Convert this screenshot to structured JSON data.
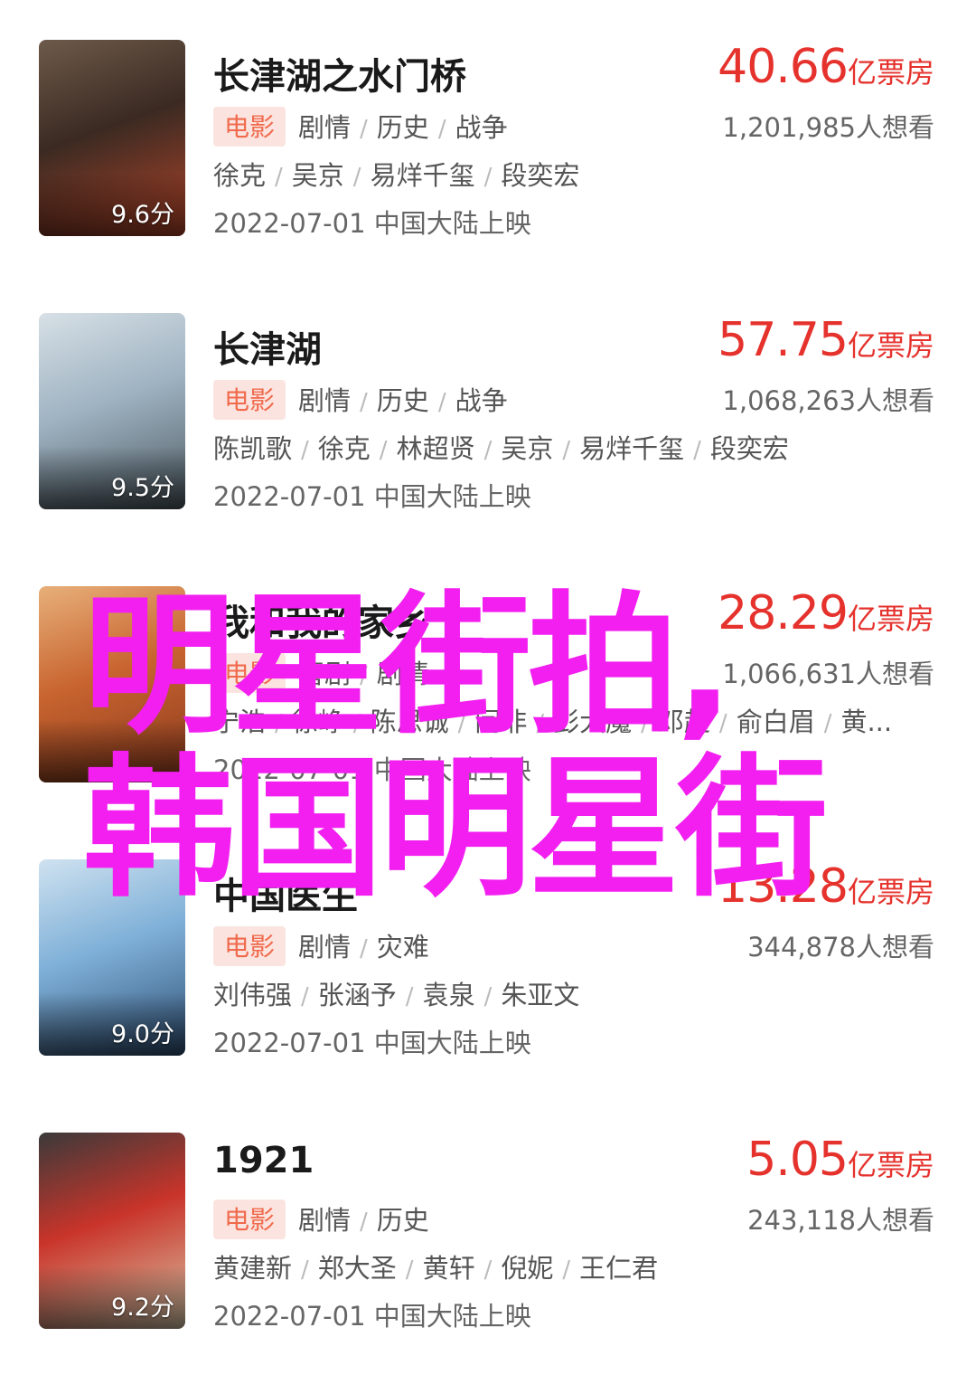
{
  "movies": [
    {
      "title": "长津湖之水门桥",
      "tag": "电影",
      "genres": [
        "剧情",
        "历史",
        "战争"
      ],
      "cast": [
        "徐克",
        "吴京",
        "易烊千玺",
        "段奕宏"
      ],
      "release": "2022-07-01 中国大陆上映",
      "score": "9.6分",
      "box_office": "40.66",
      "box_unit": "亿票房",
      "want": "1,201,985人想看",
      "poster_colors": [
        "#3b2a22",
        "#b4452a",
        "#6d5a4a"
      ]
    },
    {
      "title": "长津湖",
      "tag": "电影",
      "genres": [
        "剧情",
        "历史",
        "战争"
      ],
      "cast": [
        "陈凯歌",
        "徐克",
        "林超贤",
        "吴京",
        "易烊千玺",
        "段奕宏"
      ],
      "release": "2022-07-01 中国大陆上映",
      "score": "9.5分",
      "box_office": "57.75",
      "box_unit": "亿票房",
      "want": "1,068,263人想看",
      "poster_colors": [
        "#9fb3c2",
        "#4d5a62",
        "#d7e0e6"
      ]
    },
    {
      "title": "我和我的家乡",
      "tag": "电影",
      "genres": [
        "喜剧",
        "剧情"
      ],
      "cast": [
        "宁浩",
        "徐峥",
        "陈思诚",
        "闫非",
        "彭大魔",
        "邓超",
        "俞白眉",
        "黄..."
      ],
      "release": "2022-07-01 中国大陆上映",
      "score": "",
      "box_office": "28.29",
      "box_unit": "亿票房",
      "want": "1,066,631人想看",
      "poster_colors": [
        "#c8642f",
        "#8a3a1e",
        "#e8b07a"
      ]
    },
    {
      "title": "中国医生",
      "tag": "电影",
      "genres": [
        "剧情",
        "灾难"
      ],
      "cast": [
        "刘伟强",
        "张涵予",
        "袁泉",
        "朱亚文"
      ],
      "release": "2022-07-01 中国大陆上映",
      "score": "9.0分",
      "box_office": "13.28",
      "box_unit": "亿票房",
      "want": "344,878人想看",
      "poster_colors": [
        "#7fb0d8",
        "#2f4f74",
        "#cfe2f0"
      ]
    },
    {
      "title": "1921",
      "tag": "电影",
      "genres": [
        "剧情",
        "历史"
      ],
      "cast": [
        "黄建新",
        "郑大圣",
        "黄轩",
        "倪妮",
        "王仁君"
      ],
      "release": "2022-07-01 中国大陆上映",
      "score": "9.2分",
      "box_office": "5.05",
      "box_unit": "亿票房",
      "want": "243,118人想看",
      "poster_colors": [
        "#c9342a",
        "#d9c7a8",
        "#3a3a3a"
      ]
    }
  ],
  "overlay": {
    "line1": "明星街拍,",
    "line2": "韩国明星街",
    "color": "#f21ff0"
  }
}
